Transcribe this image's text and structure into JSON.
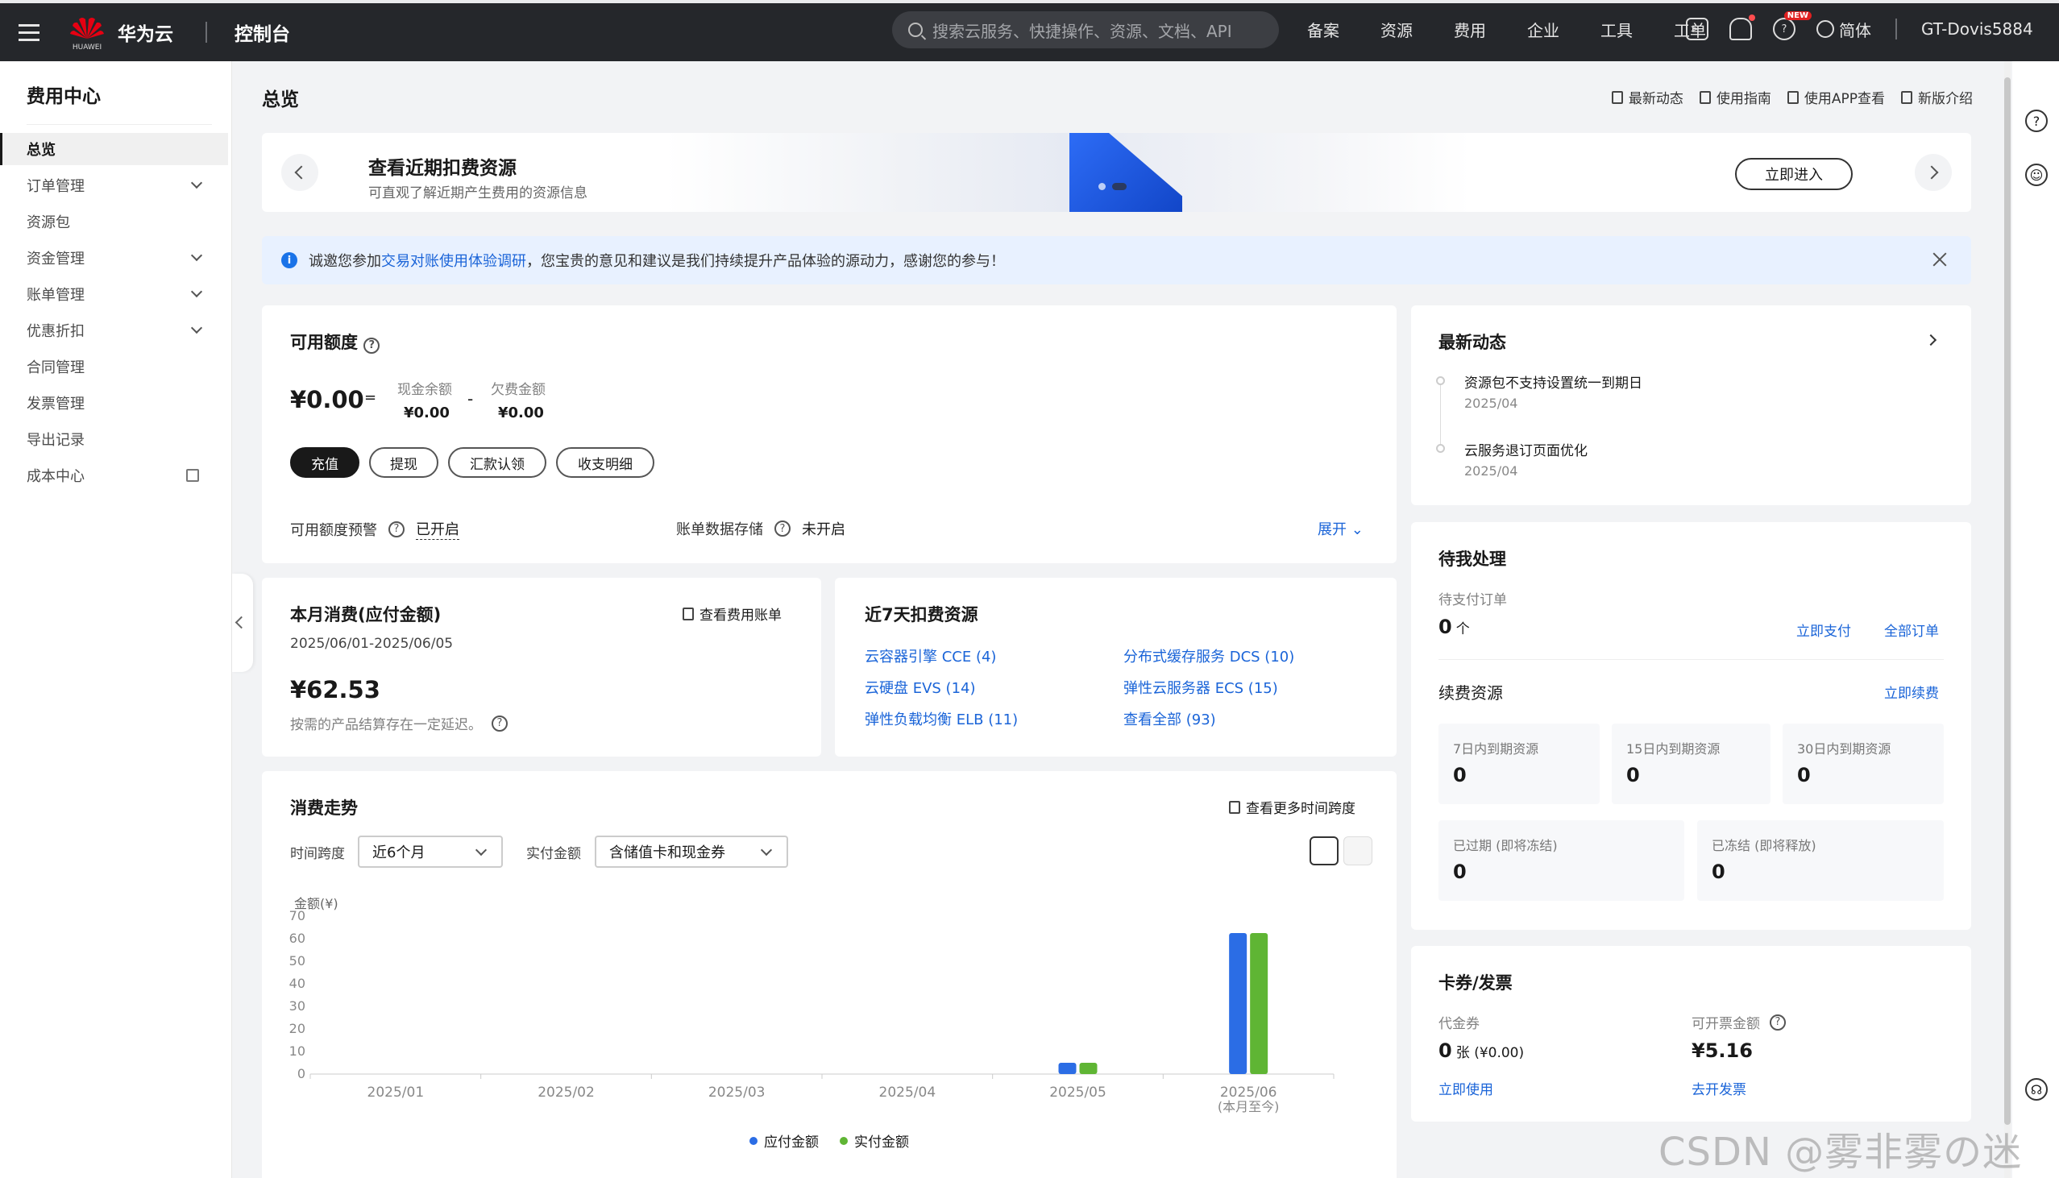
{
  "topbar": {
    "logo_sub": "HUAWEI",
    "brand": "华为云",
    "console": "控制台",
    "search_placeholder": "搜索云服务、快捷操作、资源、文档、API",
    "nav": [
      "备案",
      "资源",
      "费用",
      "企业",
      "工具",
      "工单"
    ],
    "new_badge": "NEW",
    "lang": "简体",
    "user": "GT-Dovis5884"
  },
  "sidebar": {
    "title": "费用中心",
    "items": [
      {
        "label": "总览"
      },
      {
        "label": "订单管理"
      },
      {
        "label": "资源包"
      },
      {
        "label": "资金管理"
      },
      {
        "label": "账单管理"
      },
      {
        "label": "优惠折扣"
      },
      {
        "label": "合同管理"
      },
      {
        "label": "发票管理"
      },
      {
        "label": "导出记录"
      },
      {
        "label": "成本中心"
      }
    ]
  },
  "page": {
    "title": "总览",
    "links": [
      "最新动态",
      "使用指南",
      "使用APP查看",
      "新版介绍"
    ]
  },
  "banner": {
    "title": "查看近期扣费资源",
    "subtitle": "可直观了解近期产生费用的资源信息",
    "button": "立即进入"
  },
  "notice": {
    "prefix": "诚邀您参加",
    "link": "交易对账使用体验调研",
    "suffix": "，您宝贵的意见和建议是我们持续提升产品体验的源动力，感谢您的参与！"
  },
  "balance": {
    "title": "可用额度",
    "amount": "¥0.00",
    "eq": "=",
    "minus": "-",
    "cash_label": "现金余额",
    "cash_value": "¥0.00",
    "owe_label": "欠费金额",
    "owe_value": "¥0.00",
    "buttons": [
      "充值",
      "提现",
      "汇款认领",
      "收支明细"
    ],
    "alert_label": "可用额度预警",
    "alert_value": "已开启",
    "storage_label": "账单数据存储",
    "storage_value": "未开启",
    "expand": "展开"
  },
  "monthly": {
    "title": "本月消费(应付金额)",
    "link": "查看费用账单",
    "period": "2025/06/01-2025/06/05",
    "amount": "¥62.53",
    "note": "按需的产品结算存在一定延迟。"
  },
  "recent7": {
    "title": "近7天扣费资源",
    "items": [
      "云容器引擎 CCE (4)",
      "分布式缓存服务 DCS (10)",
      "云硬盘 EVS (14)",
      "弹性云服务器 ECS (15)",
      "弹性负载均衡 ELB (11)",
      "查看全部 (93)"
    ]
  },
  "trend": {
    "title": "消费走势",
    "link": "查看更多时间跨度",
    "span_label": "时间跨度",
    "span_value": "近6个月",
    "paid_label": "实付金额",
    "paid_value": "含储值卡和现金券"
  },
  "chart_data": {
    "type": "bar",
    "ylabel": "金额(¥)",
    "ylim": [
      0,
      70
    ],
    "yticks": [
      0,
      10,
      20,
      30,
      40,
      50,
      60,
      70
    ],
    "categories": [
      "2025/01",
      "2025/02",
      "2025/03",
      "2025/04",
      "2025/05",
      "2025/06"
    ],
    "category_note": "(本月至今)",
    "series": [
      {
        "name": "应付金额",
        "color": "#2b6de5",
        "values": [
          0,
          0,
          0,
          0,
          5,
          62.5
        ]
      },
      {
        "name": "实付金额",
        "color": "#5fb534",
        "values": [
          0,
          0,
          0,
          0,
          5,
          62.5
        ]
      }
    ],
    "legend": "bottom"
  },
  "news": {
    "title": "最新动态",
    "items": [
      {
        "text": "资源包不支持设置统一到期日",
        "date": "2025/04"
      },
      {
        "text": "云服务退订页面优化",
        "date": "2025/04"
      }
    ]
  },
  "todo": {
    "title": "待我处理",
    "pending_label": "待支付订单",
    "pending_value": "0",
    "pending_unit": "个",
    "pay_now": "立即支付",
    "all_orders": "全部订单",
    "renew_title": "续费资源",
    "renew_now": "立即续费",
    "boxes": [
      {
        "label": "7日内到期资源",
        "value": "0"
      },
      {
        "label": "15日内到期资源",
        "value": "0"
      },
      {
        "label": "30日内到期资源",
        "value": "0"
      },
      {
        "label": "已过期 (即将冻结)",
        "value": "0"
      },
      {
        "label": "已冻结 (即将释放)",
        "value": "0"
      }
    ]
  },
  "coupon": {
    "title": "卡券/发票",
    "voucher_label": "代金券",
    "voucher_value": "0",
    "voucher_unit": "张 (¥0.00)",
    "use_now": "立即使用",
    "invoice_label": "可开票金额",
    "invoice_value": "¥5.16",
    "invoice_link": "去开发票"
  },
  "watermark": "CSDN @雾非雾の迷惘"
}
